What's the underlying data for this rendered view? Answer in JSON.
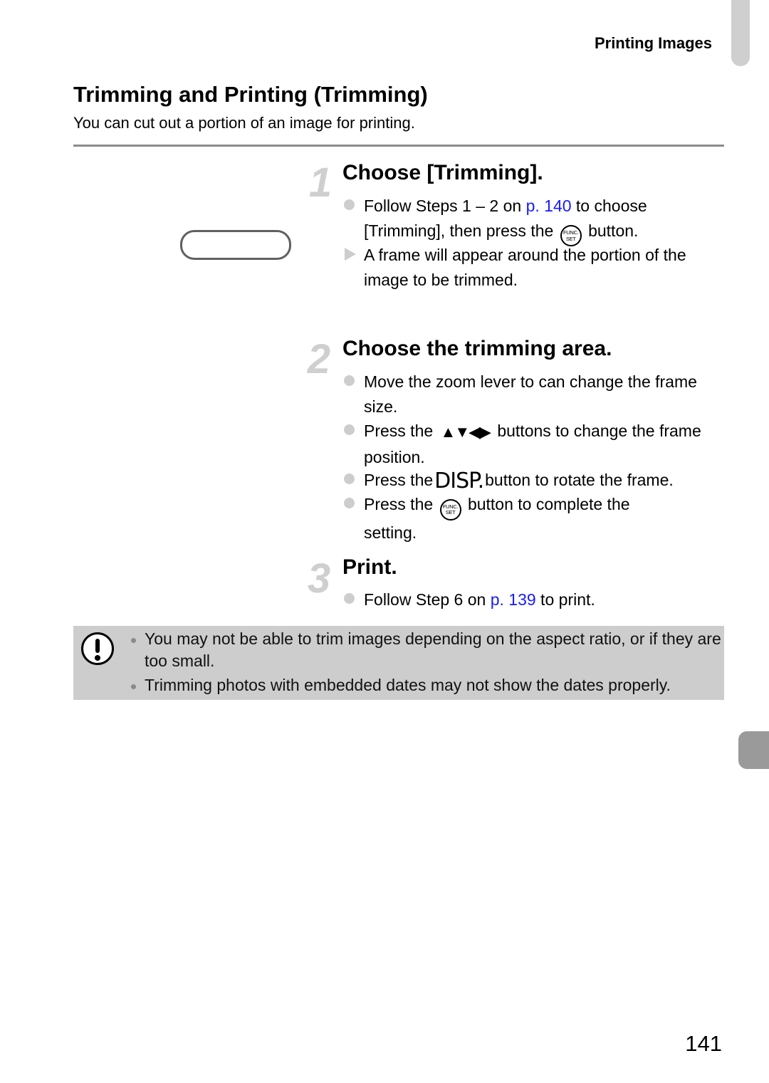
{
  "header": {
    "section": "Printing Images"
  },
  "title": "Trimming and Printing (Trimming)",
  "subtitle": "You can cut out a portion of an image for printing.",
  "steps": [
    {
      "number": "1",
      "title": "Choose [Trimming].",
      "items": [
        {
          "type": "bullet",
          "parts": {
            "a": "Follow Steps 1 – 2 on ",
            "link": "p. 140",
            "b": " to choose",
            "c": "[Trimming], then press the",
            "icon": "func-set-icon",
            "d": "button."
          }
        },
        {
          "type": "result",
          "text": "A frame will appear around the portion of the image to be trimmed."
        }
      ]
    },
    {
      "number": "2",
      "title": "Choose the trimming area.",
      "items": [
        {
          "type": "bullet",
          "text": "Move the zoom lever to can change the frame size."
        },
        {
          "type": "bullet",
          "a": "Press the",
          "icon": "up-down-left-right-arrows-icon",
          "icon_glyphs": "▲▼◀▶",
          "b": "buttons to change the frame position."
        },
        {
          "type": "bullet",
          "a": "Press the",
          "icon": "disp-button-icon",
          "icon_text": "DISP.",
          "b": "button to rotate the frame."
        },
        {
          "type": "bullet",
          "a": "Press the",
          "icon": "func-set-icon",
          "b": "button to complete the setting."
        }
      ]
    },
    {
      "number": "3",
      "title": "Print.",
      "items": [
        {
          "type": "bullet",
          "a": "Follow Step 6 on ",
          "link": "p. 139",
          "b": " to print."
        }
      ]
    }
  ],
  "func_icon": {
    "line1": "FUNC.",
    "line2": "SET"
  },
  "caution": {
    "icon": "caution-icon",
    "items": [
      "You may not be able to trim images depending on the aspect ratio, or if they are too small.",
      "Trimming photos with embedded dates may not show the dates properly."
    ]
  },
  "page_number": "141",
  "colors": {
    "link": "#1a1aff",
    "caution_bg": "#cdcdcd",
    "step_number": "#cfcfcf",
    "side_tab": "#9a9a9a"
  }
}
